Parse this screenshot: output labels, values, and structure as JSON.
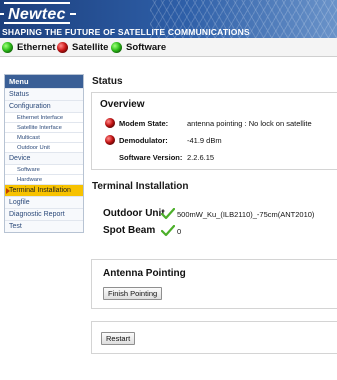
{
  "header": {
    "logo": "Newtec",
    "tagline": "SHAPING THE FUTURE OF SATELLITE COMMUNICATIONS"
  },
  "status_bar": [
    {
      "label": "Ethernet",
      "state": "green"
    },
    {
      "label": "Satellite",
      "state": "red"
    },
    {
      "label": "Software",
      "state": "green"
    }
  ],
  "menu": {
    "title": "Menu",
    "items": [
      {
        "label": "Status",
        "level": 1
      },
      {
        "label": "Configuration",
        "level": 1
      },
      {
        "label": "Ethernet Interface",
        "level": 2
      },
      {
        "label": "Satellite Interface",
        "level": 2
      },
      {
        "label": "Multicast",
        "level": 2
      },
      {
        "label": "Outdoor Unit",
        "level": 2
      },
      {
        "label": "Device",
        "level": 1
      },
      {
        "label": "Software",
        "level": 2
      },
      {
        "label": "Hardware",
        "level": 2
      },
      {
        "label": "Terminal Installation",
        "level": 1,
        "active": true
      },
      {
        "label": "Logfile",
        "level": 1
      },
      {
        "label": "Diagnostic Report",
        "level": 1
      },
      {
        "label": "Test",
        "level": 1
      }
    ]
  },
  "status": {
    "heading": "Status",
    "overview": {
      "heading": "Overview",
      "modem_state_label": "Modem State:",
      "modem_state_value": "antenna pointing : No lock on satellite",
      "demodulator_label": "Demodulator:",
      "demodulator_value": "-41.9 dBm",
      "software_version_label": "Software Version:",
      "software_version_value": "2.2.6.15"
    }
  },
  "terminal_installation": {
    "heading": "Terminal Installation",
    "outdoor_unit_label": "Outdoor Unit",
    "outdoor_unit_value": "500mW_Ku_(ILB2110)_-75cm(ANT2010)",
    "spot_beam_label": "Spot Beam",
    "spot_beam_value": "0"
  },
  "antenna_pointing": {
    "heading": "Antenna Pointing",
    "finish_button": "Finish Pointing"
  },
  "restart_button": "Restart",
  "colors": {
    "banner": "#1c3f7d",
    "menu_title": "#3a5f96",
    "menu_active": "#f7c200",
    "menu_link": "#2c4a7a",
    "check": "#4caf2a"
  }
}
